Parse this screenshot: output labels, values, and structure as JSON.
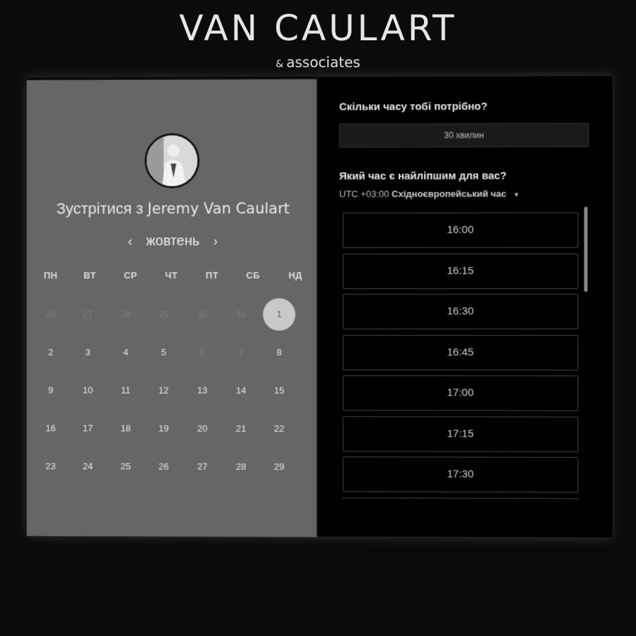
{
  "brand": {
    "title": "VAN CAULART",
    "subtitle_amp": "&",
    "subtitle": "associates"
  },
  "left": {
    "meet_prefix": "Зустрітися з",
    "host_name": "Jeremy Van Caulart",
    "month": "жовтень",
    "weekdays": [
      "ПН",
      "ВТ",
      "СР",
      "ЧТ",
      "ПТ",
      "СБ",
      "НД"
    ],
    "weeks": [
      [
        "26",
        "27",
        "28",
        "29",
        "30",
        "31",
        "1"
      ],
      [
        "2",
        "3",
        "4",
        "5",
        "6",
        "7",
        "8"
      ],
      [
        "9",
        "10",
        "11",
        "12",
        "13",
        "14",
        "15"
      ],
      [
        "16",
        "17",
        "18",
        "19",
        "20",
        "21",
        "22"
      ],
      [
        "23",
        "24",
        "25",
        "26",
        "27",
        "28",
        "29"
      ]
    ],
    "selected_day": "1"
  },
  "right": {
    "duration_question": "Скільки часу тобі потрібно?",
    "duration_value": "30 хвилин",
    "time_question": "Який час є найліпшим для вас?",
    "tz_offset": "UTC +03:00",
    "tz_name": "Східноєвропейський час",
    "slots": [
      "16:00",
      "16:15",
      "16:30",
      "16:45",
      "17:00",
      "17:15",
      "17:30"
    ]
  }
}
